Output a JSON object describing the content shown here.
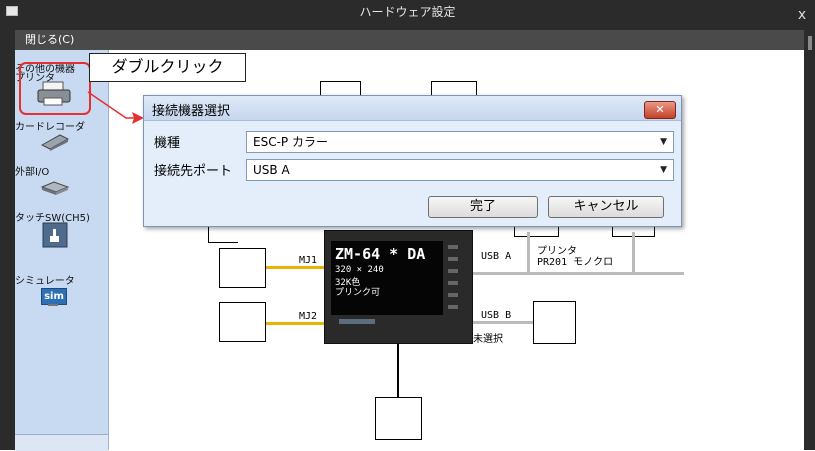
{
  "window": {
    "title": "ハードウェア設定",
    "close_glyph": "x"
  },
  "menu": {
    "close_label": "閉じる(C)"
  },
  "sidebar": {
    "items": [
      {
        "label": "その他の機器"
      },
      {
        "label": "プリンタ",
        "icon": "printer-icon"
      },
      {
        "label": "カードレコーダ",
        "icon": "card-recorder-icon"
      },
      {
        "label": "外部I/O",
        "icon": "external-io-icon"
      },
      {
        "label": "タッチSW(CH5)",
        "icon": "touch-switch-icon"
      },
      {
        "label": "シミュレータ",
        "icon": "simulator-icon",
        "badge": "sim"
      }
    ]
  },
  "callout": {
    "text": "ダブルクリック"
  },
  "dialog": {
    "title": "接続機器選択",
    "close_glyph": "✕",
    "model_label": "機種",
    "model_value": "ESC-P カラー",
    "port_label": "接続先ポート",
    "port_value": "USB A",
    "ok_label": "完了",
    "cancel_label": "キャンセル"
  },
  "diagram": {
    "port_mj1": "MJ1",
    "port_mj2": "MJ2",
    "port_usba": "USB A",
    "port_usbb": "USB B",
    "printer_label_line1": "プリンタ",
    "printer_label_line2": "PR201 モノクロ",
    "comm_unit_label": "通信ユニット未選択",
    "hmi": {
      "model": "ZM-64 * DA",
      "res": "320 × 240",
      "colors": "32K色",
      "print": "プリンク可"
    }
  },
  "colors": {
    "serial_line": "#e8b400",
    "highlight": "#e53030",
    "arrow": "#e53030"
  }
}
